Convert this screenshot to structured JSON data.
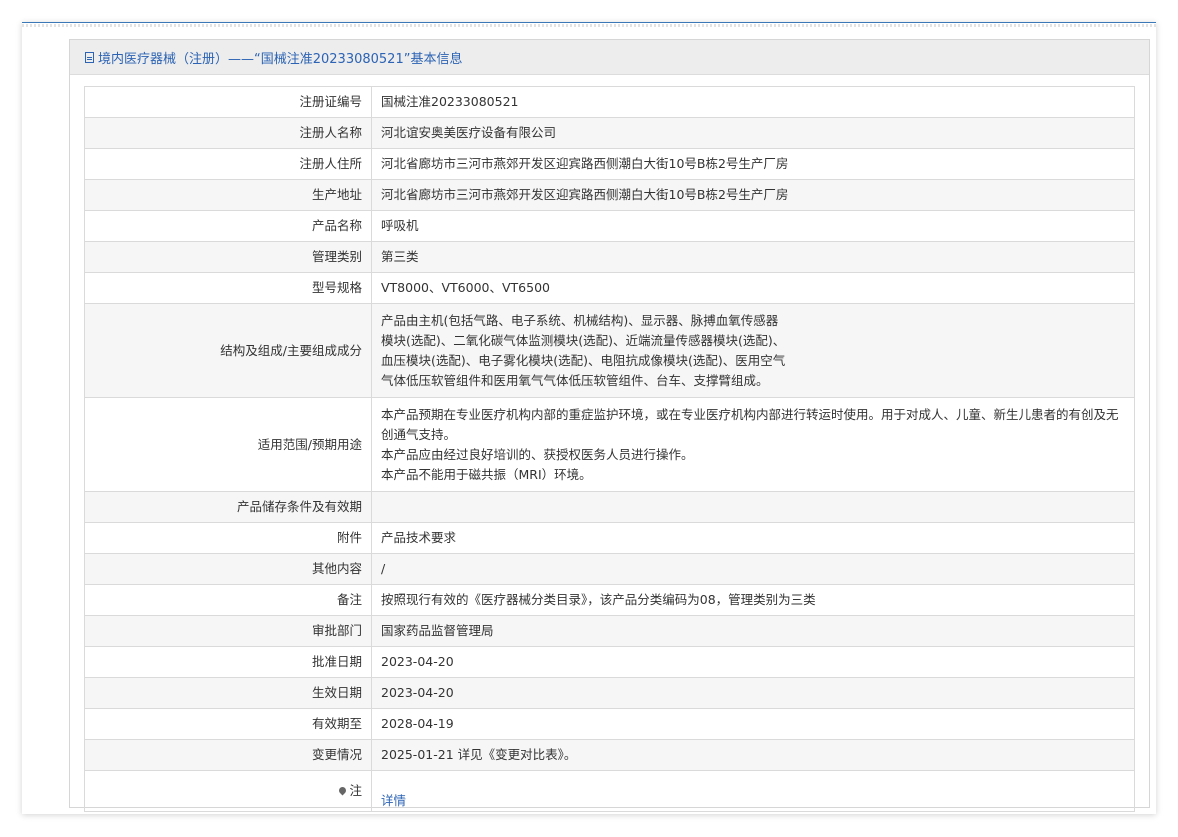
{
  "header": {
    "title": "境内医疗器械（注册）——“国械注准20233080521”基本信息",
    "icon": "document-icon"
  },
  "rows": [
    {
      "label": "注册证编号",
      "value": "国械注准20233080521"
    },
    {
      "label": "注册人名称",
      "value": "河北谊安奥美医疗设备有限公司"
    },
    {
      "label": "注册人住所",
      "value": "河北省廊坊市三河市燕郊开发区迎宾路西侧潮白大街10号B栋2号生产厂房"
    },
    {
      "label": "生产地址",
      "value": "河北省廊坊市三河市燕郊开发区迎宾路西侧潮白大街10号B栋2号生产厂房"
    },
    {
      "label": "产品名称",
      "value": "呼吸机"
    },
    {
      "label": "管理类别",
      "value": "第三类"
    },
    {
      "label": "型号规格",
      "value": "VT8000、VT6000、VT6500"
    },
    {
      "label": "结构及组成/主要组成成分",
      "value": "产品由主机(包括气路、电子系统、机械结构)、显示器、脉搏血氧传感器\n模块(选配)、二氧化碳气体监测模块(选配)、近端流量传感器模块(选配)、\n血压模块(选配)、电子雾化模块(选配)、电阻抗成像模块(选配)、医用空气\n气体低压软管组件和医用氧气气体低压软管组件、台车、支撑臂组成。"
    },
    {
      "label": "适用范围/预期用途",
      "value": "本产品预期在专业医疗机构内部的重症监护环境，或在专业医疗机构内部进行转运时使用。用于对成人、儿童、新生儿患者的有创及无创通气支持。\n本产品应由经过良好培训的、获授权医务人员进行操作。\n本产品不能用于磁共振（MRI）环境。"
    },
    {
      "label": "产品储存条件及有效期",
      "value": ""
    },
    {
      "label": "附件",
      "value": "产品技术要求"
    },
    {
      "label": "其他内容",
      "value": "/"
    },
    {
      "label": "备注",
      "value": "按照现行有效的《医疗器械分类目录》，该产品分类编码为08，管理类别为三类"
    },
    {
      "label": "审批部门",
      "value": "国家药品监督管理局"
    },
    {
      "label": "批准日期",
      "value": "2023-04-20"
    },
    {
      "label": "生效日期",
      "value": "2023-04-20"
    },
    {
      "label": "有效期至",
      "value": "2028-04-19"
    },
    {
      "label": "变更情况",
      "value": "2025-01-21 详见《变更对比表》。"
    },
    {
      "label": "注",
      "value": "详情",
      "icon": "location-pin-icon"
    }
  ],
  "colors": {
    "accent": "#2c63b4",
    "header_bg": "#ededed",
    "stripe": "#f6f6f6",
    "border": "#dadada"
  }
}
